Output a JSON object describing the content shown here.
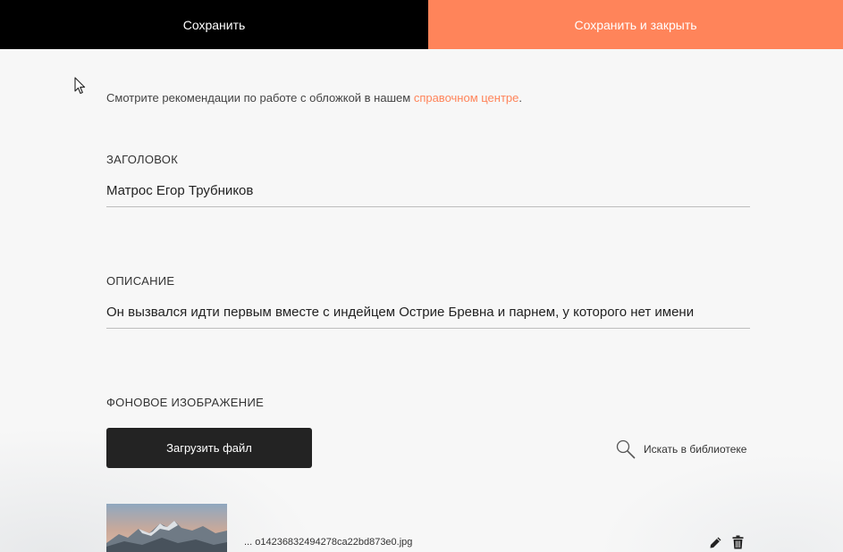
{
  "toolbar": {
    "save_label": "Сохранить",
    "save_close_label": "Сохранить и закрыть",
    "save_bg": "#000000",
    "accent": "#ff845a"
  },
  "hint": {
    "text_before": "Смотрите рекомендации по работе с обложкой в нашем ",
    "link_text": "справочном центре",
    "text_after": "."
  },
  "form": {
    "title": {
      "label": "ЗАГОЛОВОК",
      "value": "Матрос Егор Трубников"
    },
    "description": {
      "label": "ОПИСАНИЕ",
      "value": "Он вызвался идти первым вместе с индейцем Острие Бревна и парнем, у которого нет имени"
    },
    "background": {
      "label": "ФОНОВОЕ ИЗОБРАЖЕНИЕ",
      "upload_label": "Загрузить файл",
      "search_label": "Искать в библиотеке",
      "file_name": "... o14236832494278ca22bd873e0.jpg"
    }
  },
  "icons": {
    "cursor": "mouse-pointer-icon",
    "search": "magnifier-icon",
    "edit": "pencil-icon",
    "delete": "trash-icon",
    "thumbnail": "mountain-thumbnail"
  }
}
